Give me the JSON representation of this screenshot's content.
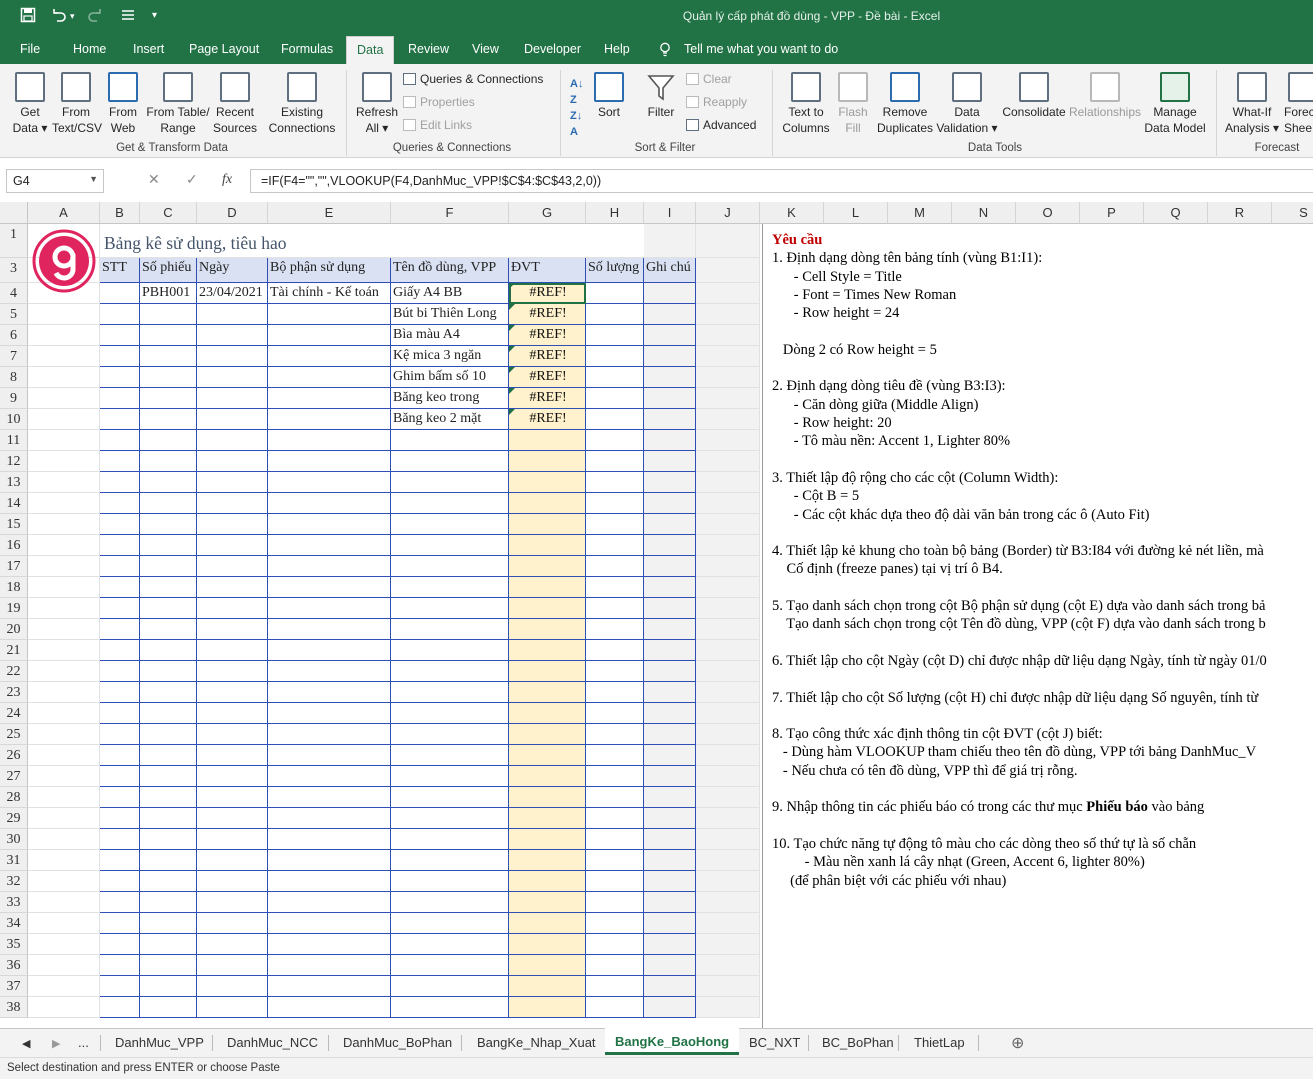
{
  "title_bar": {
    "window_title": "Quản lý cấp phát đồ dùng - VPP - Đề bài  -  Excel",
    "save_icon": "save-icon",
    "undo_icon": "undo-icon",
    "redo_icon": "redo-icon",
    "customize_icon": "customize-qat-icon"
  },
  "ribbon_tabs": [
    "File",
    "Home",
    "Insert",
    "Page Layout",
    "Formulas",
    "Data",
    "Review",
    "View",
    "Developer",
    "Help",
    "Tell me what you want to do"
  ],
  "ribbon": {
    "get_data": [
      "Get",
      "Data ▾"
    ],
    "from_text": [
      "From",
      "Text/CSV"
    ],
    "from_web": [
      "From",
      "Web"
    ],
    "from_table": [
      "From Table/",
      "Range"
    ],
    "recent_sources": [
      "Recent",
      "Sources"
    ],
    "existing_conn": [
      "Existing",
      "Connections"
    ],
    "group_get_transform": "Get & Transform Data",
    "refresh_all": [
      "Refresh",
      "All ▾"
    ],
    "queries_connections": "Queries & Connections",
    "properties": "Properties",
    "edit_links": "Edit Links",
    "group_queries": "Queries & Connections",
    "sort": "Sort",
    "filter": "Filter",
    "clear": "Clear",
    "reapply": "Reapply",
    "advanced": "Advanced",
    "group_sort": "Sort & Filter",
    "text_to_columns": [
      "Text to",
      "Columns"
    ],
    "flash_fill": [
      "Flash",
      "Fill"
    ],
    "remove_duplicates": [
      "Remove",
      "Duplicates"
    ],
    "data_validation": [
      "Data",
      "Validation ▾"
    ],
    "consolidate": "Consolidate",
    "relationships": "Relationships",
    "manage_model": [
      "Manage",
      "Data Model"
    ],
    "group_data_tools": "Data Tools",
    "what_if": [
      "What-If",
      "Analysis ▾"
    ],
    "forecast_sheet": [
      "Forec",
      "Shee"
    ],
    "group_forecast": "Forecast"
  },
  "formula_bar": {
    "name_box": "G4",
    "formula": "=IF(F4=\"\",\"\",VLOOKUP(F4,DanhMuc_VPP!$C$4:$C$43,2,0))"
  },
  "columns": [
    "A",
    "B",
    "C",
    "D",
    "E",
    "F",
    "G",
    "H",
    "I",
    "J",
    "K",
    "L",
    "M",
    "N",
    "O",
    "P",
    "Q",
    "R",
    "S"
  ],
  "rows": [
    "1",
    "3",
    "4",
    "5",
    "6",
    "7",
    "8",
    "9",
    "10",
    "11",
    "12",
    "13",
    "14",
    "15",
    "16",
    "17",
    "18",
    "19",
    "20",
    "21",
    "22",
    "23",
    "24",
    "25",
    "26",
    "27",
    "28",
    "29",
    "30",
    "31",
    "32",
    "33",
    "34",
    "35",
    "36",
    "37",
    "38"
  ],
  "sheet": {
    "title": "Bảng kê sử dụng, tiêu hao",
    "headers": [
      "STT",
      "Số phiếu",
      "Ngày",
      "Bộ phận sử dụng",
      "Tên đồ dùng, VPP",
      "ĐVT",
      "Số lượng",
      "Ghi chú"
    ],
    "row4": {
      "so_phieu": "PBH001",
      "ngay": "23/04/2021",
      "bo_phan": "Tài chính - Kế toán"
    },
    "items": [
      "Giấy A4 BB",
      "Bút bi Thiên Long",
      "Bìa màu A4",
      "Kệ mica 3 ngăn",
      "Ghim bấm số 10",
      "Băng keo trong",
      "Băng keo 2 mặt"
    ],
    "dvt_value": "#REF!"
  },
  "requirements": [
    {
      "text": "Yêu cầu",
      "style": "heading"
    },
    {
      "text": "1. Định dạng dòng tên bảng tính (vùng B1:I1):"
    },
    {
      "text": "      - Cell Style = Title"
    },
    {
      "text": "      - Font = Times New Roman"
    },
    {
      "text": "      - Row height = 24"
    },
    {
      "text": ""
    },
    {
      "text": "   Dòng 2 có Row height = 5"
    },
    {
      "text": ""
    },
    {
      "text": "2. Định dạng dòng tiêu đề (vùng B3:I3):"
    },
    {
      "text": "      - Căn dòng giữa (Middle Align)"
    },
    {
      "text": "      - Row height: 20"
    },
    {
      "text": "      - Tô màu nền: Accent 1, Lighter 80%"
    },
    {
      "text": ""
    },
    {
      "text": "3. Thiết lập độ rộng cho các cột (Column Width):"
    },
    {
      "text": "      - Cột B = 5"
    },
    {
      "text": "      - Các cột khác dựa theo độ dài văn bản trong các ô (Auto Fit)"
    },
    {
      "text": ""
    },
    {
      "text": "4. Thiết lập kẻ khung cho toàn bộ bảng (Border) từ B3:I84 với đường kẻ nét liền, mà"
    },
    {
      "text": "    Cố định (freeze panes) tại vị trí ô B4."
    },
    {
      "text": ""
    },
    {
      "text": "5. Tạo danh sách chọn trong cột Bộ phận sử dụng (cột E) dựa vào danh sách trong bả"
    },
    {
      "text": "    Tạo danh sách chọn trong cột Tên đồ dùng, VPP (cột F) dựa vào danh sách trong b"
    },
    {
      "text": ""
    },
    {
      "text": "6. Thiết lập cho cột Ngày (cột D) chỉ được nhập dữ liệu dạng Ngày, tính từ ngày 01/0"
    },
    {
      "text": ""
    },
    {
      "text": "7. Thiết lập cho cột Số lượng (cột H) chỉ được nhập dữ liệu dạng Số nguyên, tính từ"
    },
    {
      "text": ""
    },
    {
      "text": "8. Tạo công thức xác định thông tin cột ĐVT (cột J) biết:"
    },
    {
      "text": "   - Dùng hàm VLOOKUP tham chiếu theo tên đồ dùng, VPP tới bảng DanhMuc_V"
    },
    {
      "text": "   - Nếu chưa có tên đồ dùng, VPP thì để giá trị rỗng."
    },
    {
      "text": ""
    },
    {
      "text": "9. Nhập thông tin các phiếu báo có trong các thư mục ",
      "bold_tail": "Phiếu báo",
      "tail": " vào bảng"
    },
    {
      "text": ""
    },
    {
      "text": "10. Tạo chức năng tự động tô màu cho các dòng theo số thứ tự là số chẵn"
    },
    {
      "text": "         - Màu nền xanh lá cây nhạt (Green, Accent 6, lighter 80%)"
    },
    {
      "text": "     (để phân biệt với các phiếu với nhau)"
    }
  ],
  "sheet_tabs": [
    "...",
    "DanhMuc_VPP",
    "DanhMuc_NCC",
    "DanhMuc_BoPhan",
    "BangKe_Nhap_Xuat",
    "BangKe_BaoHong",
    "BC_NXT",
    "BC_BoPhan",
    "ThietLap"
  ],
  "active_sheet": "BangKe_BaoHong",
  "status_text": "Select destination and press ENTER or choose Paste",
  "colors": {
    "accent": "#217346",
    "header_fill": "#d9e1f2",
    "dvt_fill": "#fff2cc",
    "border": "#2f4fb5",
    "heading_red": "#c00000"
  }
}
